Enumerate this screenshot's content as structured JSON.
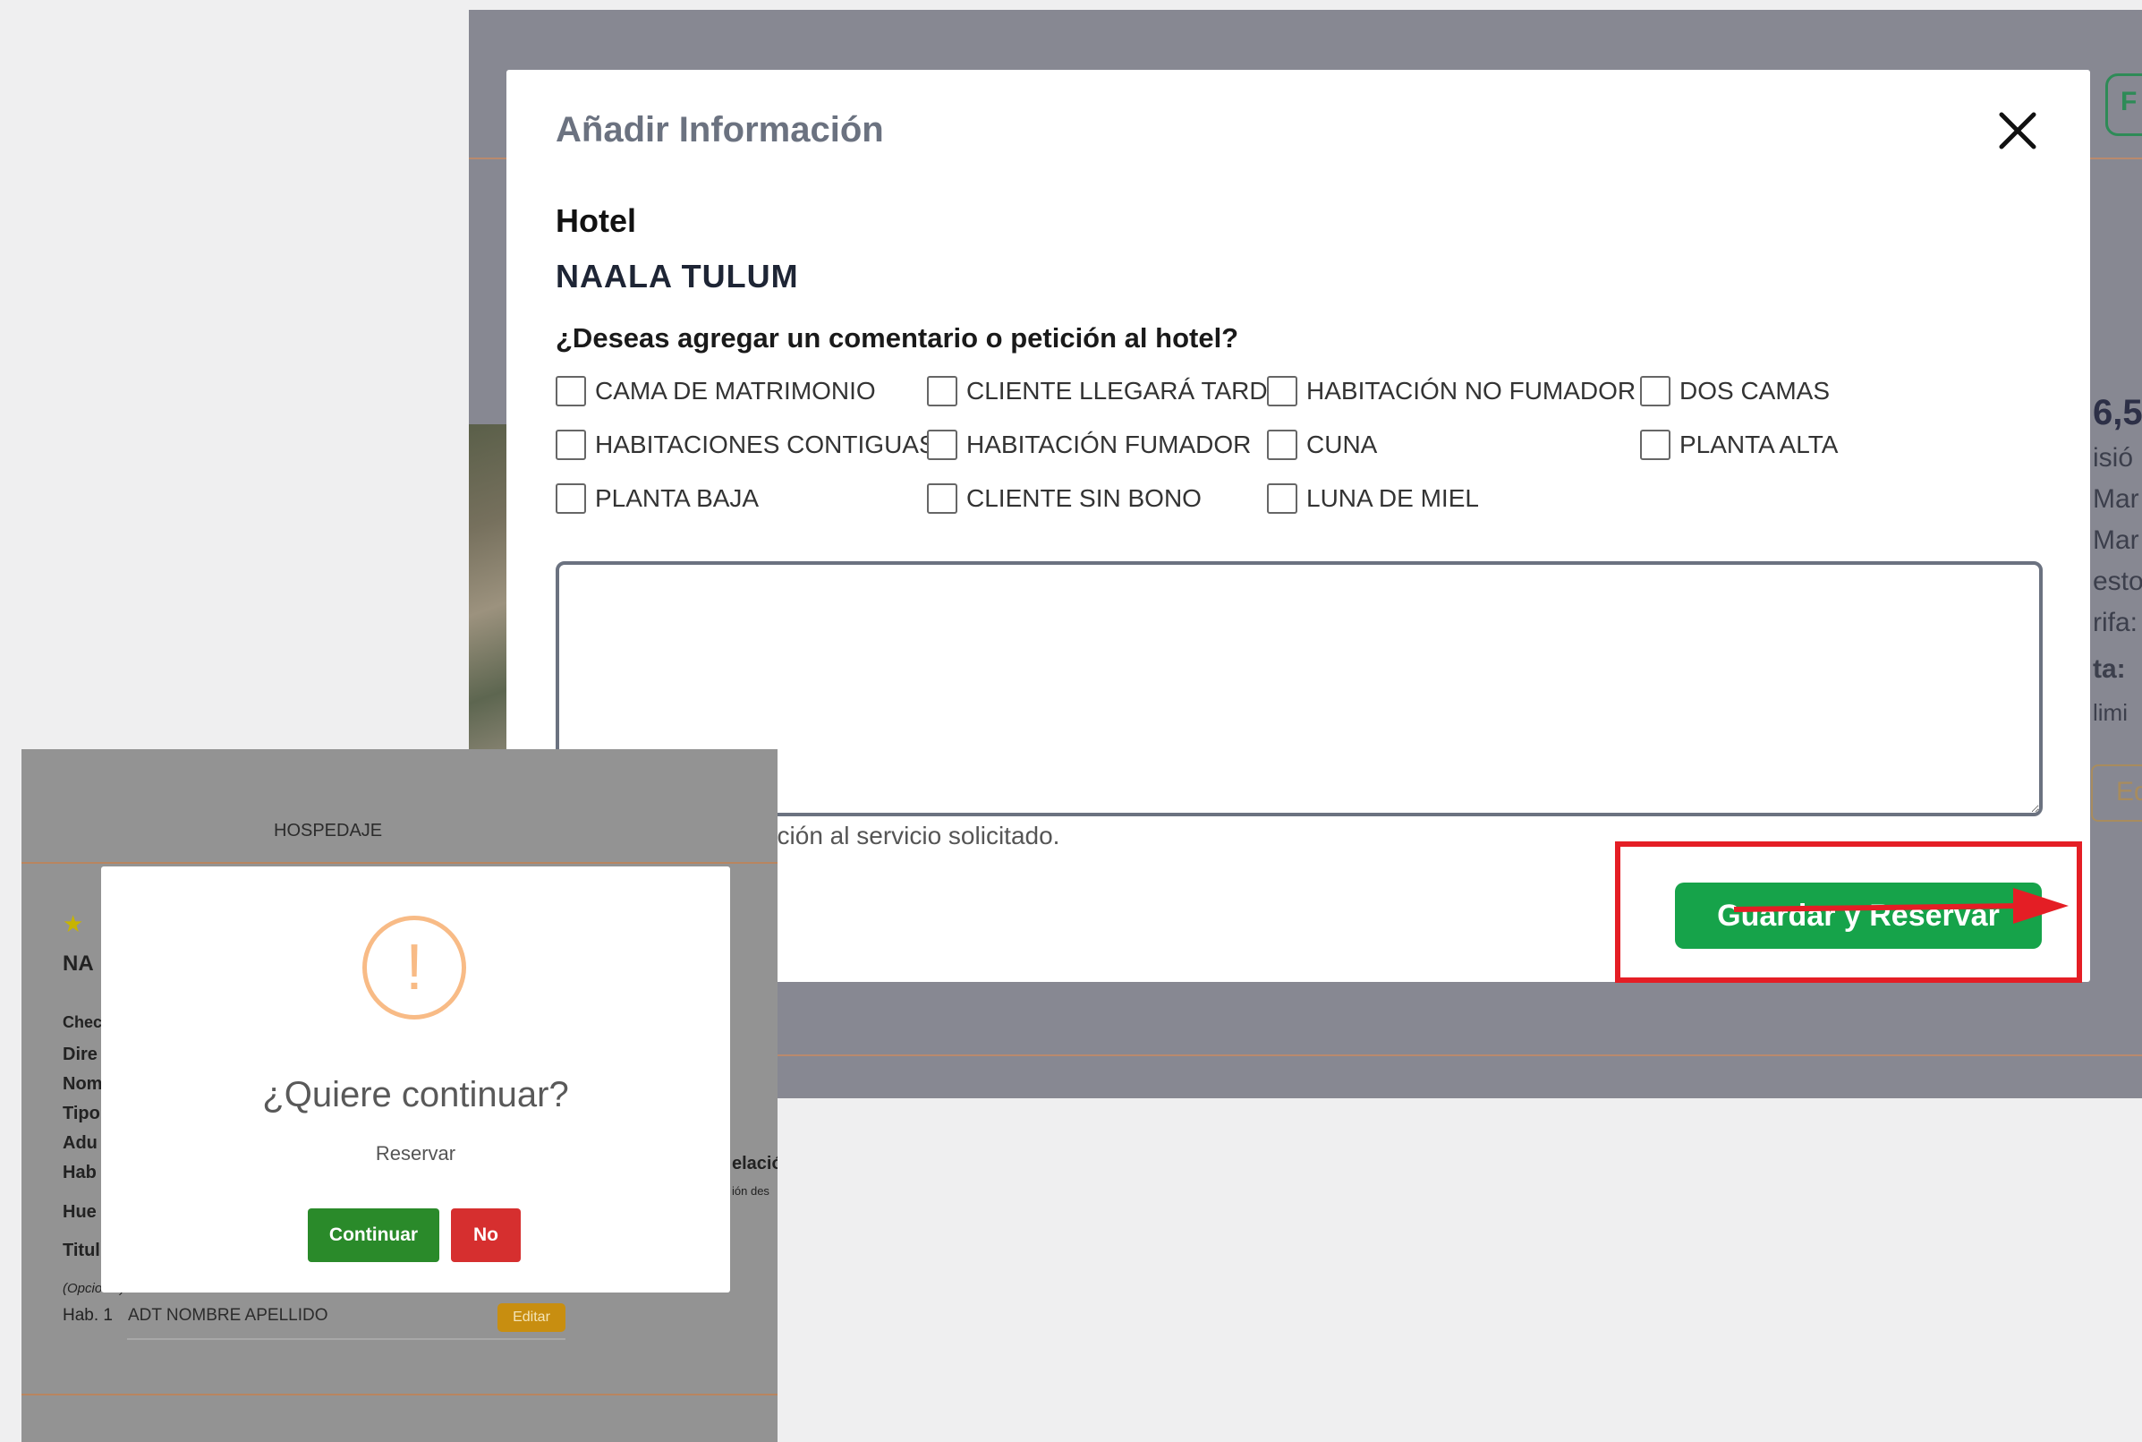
{
  "modal": {
    "title": "Añadir Información",
    "hotel_label": "Hotel",
    "hotel_name": "NAALA TULUM",
    "question": "¿Deseas agregar un comentario o petición al hotel?",
    "options": [
      "CAMA DE MATRIMONIO",
      "CLIENTE LLEGARÁ TARDE",
      "HABITACIÓN NO FUMADOR",
      "DOS CAMAS",
      "HABITACIONES CONTIGUAS",
      "HABITACIÓN FUMADOR",
      "CUNA",
      "PLANTA ALTA",
      "PLANTA BAJA",
      "CLIENTE SIN BONO",
      "LUNA DE MIEL"
    ],
    "comment_value": "",
    "note_partial": "onsable de dar atención al servicio solicitado.",
    "save_button": "Guardar y Reservar"
  },
  "background_right": {
    "button_fragment": "F",
    "price_fragment": "​6,5",
    "lines": [
      "isió",
      "Mar",
      "Mar",
      "esto",
      "rifa:",
      "ta:",
      "limi"
    ],
    "edit_fragment": "Ed"
  },
  "confirm": {
    "title": "¿Quiere continuar?",
    "text": "Reservar",
    "continue_button": "Continuar",
    "no_button": "No",
    "icon": "!"
  },
  "background_left": {
    "section_title": "HOSPEDAJE",
    "name_fragment": "NA",
    "labels": [
      "Chec",
      "Dire",
      "Nom",
      "Tipo",
      "Adu",
      "Hab",
      "Hue",
      "Titul",
      "(Opcional)"
    ],
    "right_fragments": [
      "elació",
      "ión des"
    ],
    "room_label": "Hab. 1",
    "room_guest": "ADT NOMBRE APELLIDO",
    "edit_button": "Editar"
  },
  "colors": {
    "save_green": "#16a34a",
    "highlight_red": "#e41e25",
    "continue_green": "#2a8a2a",
    "no_red": "#d62f2f",
    "warning_orange": "#f8bb86"
  }
}
